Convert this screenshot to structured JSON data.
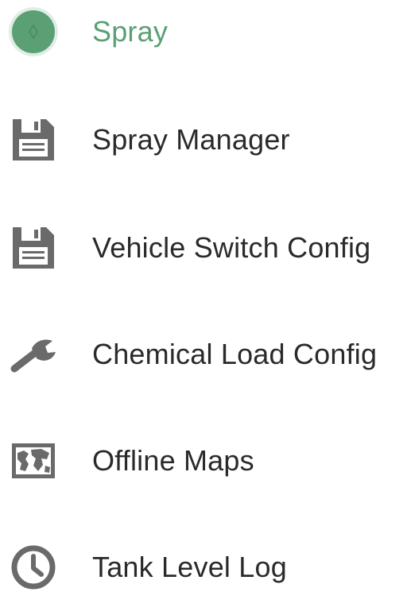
{
  "menu": {
    "items": [
      {
        "label": "Spray",
        "icon": "spray-circle-icon",
        "active": true
      },
      {
        "label": "Spray Manager",
        "icon": "save-icon",
        "active": false
      },
      {
        "label": "Vehicle Switch Config",
        "icon": "save-icon",
        "active": false
      },
      {
        "label": "Chemical Load Config",
        "icon": "wrench-icon",
        "active": false
      },
      {
        "label": "Offline Maps",
        "icon": "map-icon",
        "active": false
      },
      {
        "label": "Tank Level Log",
        "icon": "clock-icon",
        "active": false
      }
    ]
  },
  "colors": {
    "accent": "#5b9f74",
    "icon_gray": "#6a6a6a",
    "text": "#2a2a2a",
    "background": "#ffffff"
  }
}
